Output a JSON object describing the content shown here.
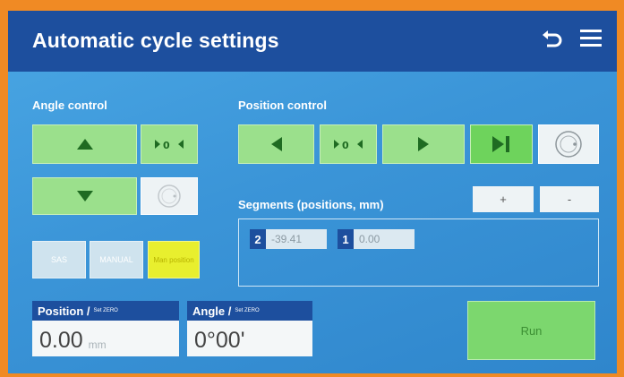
{
  "header": {
    "title": "Automatic cycle settings",
    "back_icon": "undo-arrow-icon",
    "menu_icon": "hamburger-menu-icon"
  },
  "angle_control": {
    "label": "Angle control",
    "small_buttons": [
      "SAS",
      "MANUAL",
      "Man position"
    ]
  },
  "position_control": {
    "label": "Position control"
  },
  "segments": {
    "label": "Segments (positions, mm)",
    "add_label": "+",
    "remove_label": "-",
    "items": [
      {
        "index": "2",
        "value": "-39.41"
      },
      {
        "index": "1",
        "value": "0.00"
      }
    ]
  },
  "position_readout": {
    "title": "Position /",
    "sub": "Set ZERO",
    "value": "0.00",
    "unit": "mm"
  },
  "angle_readout": {
    "title": "Angle /",
    "sub": "Set ZERO",
    "value": "0°00'"
  },
  "run_label": "Run",
  "colors": {
    "header": "#1d4f9e",
    "button_green": "#9be08c",
    "accent_yellow": "#e8ef2e"
  }
}
